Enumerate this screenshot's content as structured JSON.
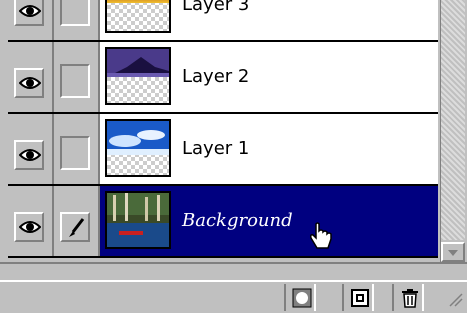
{
  "layers_panel": {
    "rows": [
      {
        "name": "Layer 3",
        "visible": true,
        "linked": false,
        "selected": false,
        "thumb": "sunset"
      },
      {
        "name": "Layer 2",
        "visible": true,
        "linked": false,
        "selected": false,
        "thumb": "mountain"
      },
      {
        "name": "Layer 1",
        "visible": true,
        "linked": false,
        "selected": false,
        "thumb": "sky"
      },
      {
        "name": "Background",
        "visible": true,
        "linked": true,
        "selected": true,
        "thumb": "forest"
      }
    ],
    "icons": {
      "visibility": "eye-icon",
      "paint": "brush-icon",
      "cursor": "hand-pointer-icon",
      "mask": "layer-mask-icon",
      "new_layer": "new-layer-icon",
      "delete": "trash-icon",
      "scroll_down": "scroll-down-arrow-icon"
    },
    "colors": {
      "selected_bg": "#000080",
      "row_bg": "#ffffff",
      "panel_bg": "#c0c0c0"
    }
  }
}
